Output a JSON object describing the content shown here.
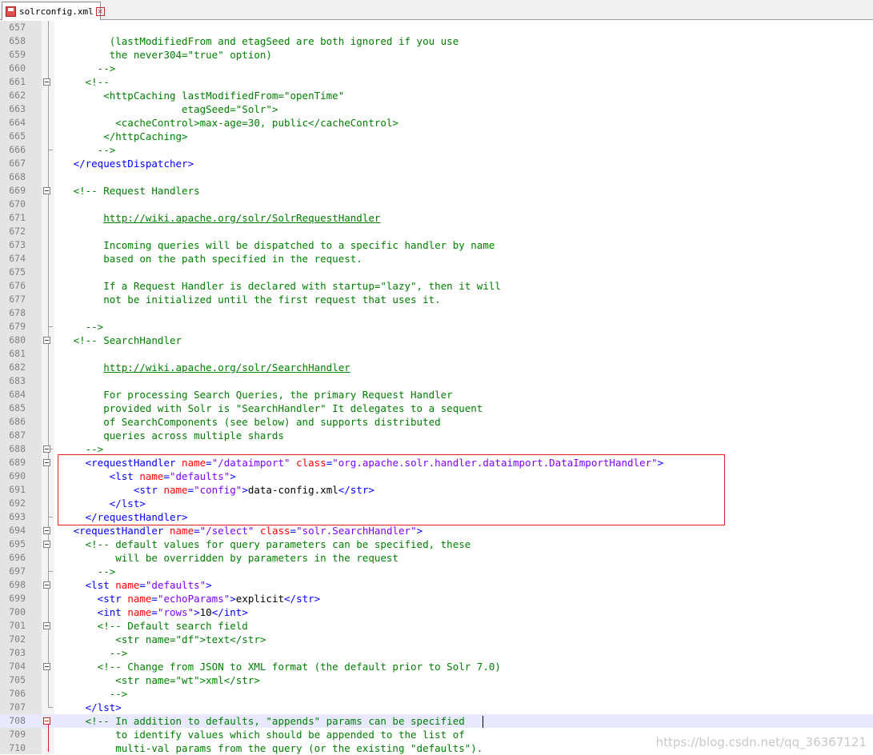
{
  "tab": {
    "label": "solrconfig.xml",
    "save_icon": "save-icon",
    "close_icon": "close-icon",
    "close_glyph": "×"
  },
  "colors": {
    "comment": "#008000",
    "tag": "#0000ff",
    "attr": "#ff0000",
    "value": "#8000ff",
    "text": "#000000",
    "line_number": "#808080",
    "highlight_box": "#e02020",
    "current_line": "#e8e8ff"
  },
  "watermark": "https://blog.csdn.net/qq_36367121",
  "lines": [
    {
      "n": "657",
      "segs": []
    },
    {
      "n": "658",
      "segs": [
        [
          "cmt",
          "         (lastModifiedFrom and etagSeed are both ignored if you use"
        ]
      ]
    },
    {
      "n": "659",
      "segs": [
        [
          "cmt",
          "         the never304=\"true\" option)"
        ]
      ]
    },
    {
      "n": "660",
      "segs": [
        [
          "cmt",
          "       -->"
        ]
      ]
    },
    {
      "n": "661",
      "segs": [
        [
          "cmt",
          "     <!--"
        ]
      ]
    },
    {
      "n": "662",
      "segs": [
        [
          "cmt",
          "        <httpCaching lastModifiedFrom=\"openTime\""
        ]
      ]
    },
    {
      "n": "663",
      "segs": [
        [
          "cmt",
          "                     etagSeed=\"Solr\">"
        ]
      ]
    },
    {
      "n": "664",
      "segs": [
        [
          "cmt",
          "          <cacheControl>max-age=30, public</cacheControl>"
        ]
      ]
    },
    {
      "n": "665",
      "segs": [
        [
          "cmt",
          "        </httpCaching>"
        ]
      ]
    },
    {
      "n": "666",
      "segs": [
        [
          "cmt",
          "       -->"
        ]
      ]
    },
    {
      "n": "667",
      "segs": [
        [
          "tag",
          "   </requestDispatcher>"
        ]
      ]
    },
    {
      "n": "668",
      "segs": []
    },
    {
      "n": "669",
      "segs": [
        [
          "cmt",
          "   <!-- Request Handlers"
        ]
      ]
    },
    {
      "n": "670",
      "segs": []
    },
    {
      "n": "671",
      "segs": [
        [
          "cmt",
          "        "
        ],
        [
          "url",
          "http://wiki.apache.org/solr/SolrRequestHandler"
        ]
      ]
    },
    {
      "n": "672",
      "segs": []
    },
    {
      "n": "673",
      "segs": [
        [
          "cmt",
          "        Incoming queries will be dispatched to a specific handler by name"
        ]
      ]
    },
    {
      "n": "674",
      "segs": [
        [
          "cmt",
          "        based on the path specified in the request."
        ]
      ]
    },
    {
      "n": "675",
      "segs": []
    },
    {
      "n": "676",
      "segs": [
        [
          "cmt",
          "        If a Request Handler is declared with startup=\"lazy\", then it will"
        ]
      ]
    },
    {
      "n": "677",
      "segs": [
        [
          "cmt",
          "        not be initialized until the first request that uses it."
        ]
      ]
    },
    {
      "n": "678",
      "segs": []
    },
    {
      "n": "679",
      "segs": [
        [
          "cmt",
          "     -->"
        ]
      ]
    },
    {
      "n": "680",
      "segs": [
        [
          "cmt",
          "   <!-- SearchHandler"
        ]
      ]
    },
    {
      "n": "681",
      "segs": []
    },
    {
      "n": "682",
      "segs": [
        [
          "cmt",
          "        "
        ],
        [
          "url",
          "http://wiki.apache.org/solr/SearchHandler"
        ]
      ]
    },
    {
      "n": "683",
      "segs": []
    },
    {
      "n": "684",
      "segs": [
        [
          "cmt",
          "        For processing Search Queries, the primary Request Handler"
        ]
      ]
    },
    {
      "n": "685",
      "segs": [
        [
          "cmt",
          "        provided with Solr is \"SearchHandler\" It delegates to a sequent"
        ]
      ]
    },
    {
      "n": "686",
      "segs": [
        [
          "cmt",
          "        of SearchComponents (see below) and supports distributed"
        ]
      ]
    },
    {
      "n": "687",
      "segs": [
        [
          "cmt",
          "        queries across multiple shards"
        ]
      ]
    },
    {
      "n": "688",
      "segs": [
        [
          "cmt",
          "     -->"
        ]
      ]
    },
    {
      "n": "689",
      "segs": [
        [
          "tag",
          "     <requestHandler "
        ],
        [
          "attr",
          "name"
        ],
        [
          "tag",
          "="
        ],
        [
          "val",
          "\"/dataimport\""
        ],
        [
          "tag",
          " "
        ],
        [
          "attr",
          "class"
        ],
        [
          "tag",
          "="
        ],
        [
          "val",
          "\"org.apache.solr.handler.dataimport.DataImportHandler\""
        ],
        [
          "tag",
          ">"
        ]
      ]
    },
    {
      "n": "690",
      "segs": [
        [
          "tag",
          "         <lst "
        ],
        [
          "attr",
          "name"
        ],
        [
          "tag",
          "="
        ],
        [
          "val",
          "\"defaults\""
        ],
        [
          "tag",
          ">"
        ]
      ]
    },
    {
      "n": "691",
      "segs": [
        [
          "tag",
          "             <str "
        ],
        [
          "attr",
          "name"
        ],
        [
          "tag",
          "="
        ],
        [
          "val",
          "\"config\""
        ],
        [
          "tag",
          ">"
        ],
        [
          "txt",
          "data-config.xml"
        ],
        [
          "tag",
          "</str>"
        ]
      ]
    },
    {
      "n": "692",
      "segs": [
        [
          "tag",
          "         </lst>"
        ]
      ]
    },
    {
      "n": "693",
      "segs": [
        [
          "tag",
          "     </requestHandler>"
        ]
      ]
    },
    {
      "n": "694",
      "segs": [
        [
          "tag",
          "   <requestHandler "
        ],
        [
          "attr",
          "name"
        ],
        [
          "tag",
          "="
        ],
        [
          "val",
          "\"/select\""
        ],
        [
          "tag",
          " "
        ],
        [
          "attr",
          "class"
        ],
        [
          "tag",
          "="
        ],
        [
          "val",
          "\"solr.SearchHandler\""
        ],
        [
          "tag",
          ">"
        ]
      ]
    },
    {
      "n": "695",
      "segs": [
        [
          "cmt",
          "     <!-- default values for query parameters can be specified, these"
        ]
      ]
    },
    {
      "n": "696",
      "segs": [
        [
          "cmt",
          "          will be overridden by parameters in the request"
        ]
      ]
    },
    {
      "n": "697",
      "segs": [
        [
          "cmt",
          "       -->"
        ]
      ]
    },
    {
      "n": "698",
      "segs": [
        [
          "tag",
          "     <lst "
        ],
        [
          "attr",
          "name"
        ],
        [
          "tag",
          "="
        ],
        [
          "val",
          "\"defaults\""
        ],
        [
          "tag",
          ">"
        ]
      ]
    },
    {
      "n": "699",
      "segs": [
        [
          "tag",
          "       <str "
        ],
        [
          "attr",
          "name"
        ],
        [
          "tag",
          "="
        ],
        [
          "val",
          "\"echoParams\""
        ],
        [
          "tag",
          ">"
        ],
        [
          "txt",
          "explicit"
        ],
        [
          "tag",
          "</str>"
        ]
      ]
    },
    {
      "n": "700",
      "segs": [
        [
          "tag",
          "       <int "
        ],
        [
          "attr",
          "name"
        ],
        [
          "tag",
          "="
        ],
        [
          "val",
          "\"rows\""
        ],
        [
          "tag",
          ">"
        ],
        [
          "txt",
          "10"
        ],
        [
          "tag",
          "</int>"
        ]
      ]
    },
    {
      "n": "701",
      "segs": [
        [
          "cmt",
          "       <!-- Default search field"
        ]
      ]
    },
    {
      "n": "702",
      "segs": [
        [
          "cmt",
          "          <str name=\"df\">text</str>"
        ]
      ]
    },
    {
      "n": "703",
      "segs": [
        [
          "cmt",
          "         -->"
        ]
      ]
    },
    {
      "n": "704",
      "segs": [
        [
          "cmt",
          "       <!-- Change from JSON to XML format (the default prior to Solr 7.0)"
        ]
      ]
    },
    {
      "n": "705",
      "segs": [
        [
          "cmt",
          "          <str name=\"wt\">xml</str>"
        ]
      ]
    },
    {
      "n": "706",
      "segs": [
        [
          "cmt",
          "         -->"
        ]
      ]
    },
    {
      "n": "707",
      "segs": [
        [
          "tag",
          "     </lst>"
        ]
      ]
    },
    {
      "n": "708",
      "segs": [
        [
          "cmt",
          "     <!-- In addition to defaults, \"appends\" params can be specified"
        ]
      ],
      "current": true
    },
    {
      "n": "709",
      "segs": [
        [
          "cmt",
          "          to identify values which should be appended to the list of"
        ]
      ]
    },
    {
      "n": "710",
      "segs": [
        [
          "cmt",
          "          multi-val params from the query (or the existing \"defaults\")."
        ]
      ]
    }
  ]
}
